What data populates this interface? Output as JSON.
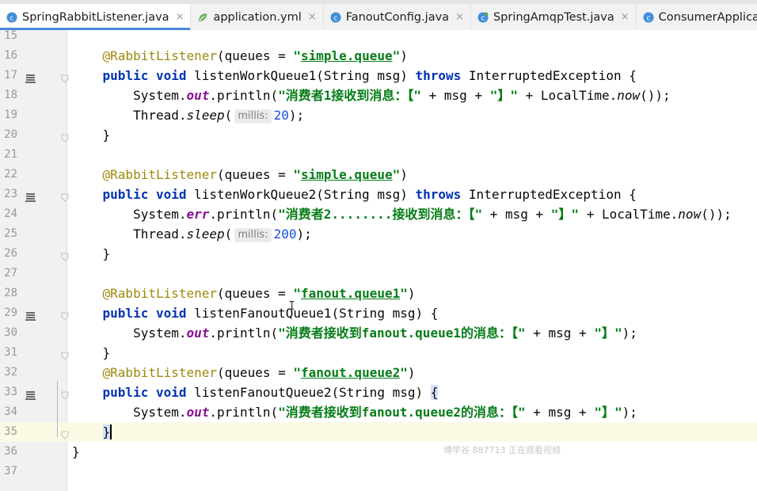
{
  "tabs": [
    {
      "label": "SpringRabbitListener.java",
      "icon": "java-class-icon",
      "active": true,
      "closable": true
    },
    {
      "label": "application.yml",
      "icon": "yml-leaf-icon",
      "active": false,
      "closable": true
    },
    {
      "label": "FanoutConfig.java",
      "icon": "java-class-icon",
      "active": false,
      "closable": true
    },
    {
      "label": "SpringAmqpTest.java",
      "icon": "java-test-class-icon",
      "active": false,
      "closable": true
    },
    {
      "label": "ConsumerApplication.java",
      "icon": "java-class-icon",
      "active": false,
      "closable": false
    }
  ],
  "close_glyph": "×",
  "code": {
    "lines": [
      {
        "n": "15",
        "tokens": []
      },
      {
        "n": "16",
        "tokens": [
          [
            "ann",
            "    @RabbitListener"
          ],
          [
            "p",
            "(queues = "
          ],
          [
            "str",
            "\""
          ],
          [
            "strlnk",
            "simple.queue"
          ],
          [
            "str",
            "\""
          ],
          [
            "p",
            ")"
          ]
        ]
      },
      {
        "n": "17",
        "run": true,
        "fold": true,
        "tokens": [
          [
            "kw",
            "    public void "
          ],
          [
            "p",
            "listenWorkQueue1(String msg) "
          ],
          [
            "kw",
            "throws "
          ],
          [
            "p",
            "InterruptedException {"
          ]
        ]
      },
      {
        "n": "18",
        "tokens": [
          [
            "p",
            "        System."
          ],
          [
            "fld",
            "out"
          ],
          [
            "p",
            ".println("
          ],
          [
            "str",
            "\"消费者1接收到消息：【\""
          ],
          [
            "p",
            " + msg + "
          ],
          [
            "str",
            "\"】\""
          ],
          [
            "p",
            " + LocalTime."
          ],
          [
            "itl",
            "now"
          ],
          [
            "p",
            "());"
          ]
        ]
      },
      {
        "n": "19",
        "tokens": [
          [
            "p",
            "        Thread."
          ],
          [
            "itl",
            "sleep"
          ],
          [
            "p",
            "("
          ],
          [
            "hint",
            "millis:"
          ],
          [
            "num",
            "20"
          ],
          [
            "p",
            ");"
          ]
        ]
      },
      {
        "n": "20",
        "fold": true,
        "tokens": [
          [
            "p",
            "    }"
          ]
        ]
      },
      {
        "n": "21",
        "tokens": []
      },
      {
        "n": "22",
        "tokens": [
          [
            "ann",
            "    @RabbitListener"
          ],
          [
            "p",
            "(queues = "
          ],
          [
            "str",
            "\""
          ],
          [
            "strlnk",
            "simple.queue"
          ],
          [
            "str",
            "\""
          ],
          [
            "p",
            ")"
          ]
        ]
      },
      {
        "n": "23",
        "run": true,
        "fold": true,
        "tokens": [
          [
            "kw",
            "    public void "
          ],
          [
            "p",
            "listenWorkQueue2(String msg) "
          ],
          [
            "kw",
            "throws "
          ],
          [
            "p",
            "InterruptedException {"
          ]
        ]
      },
      {
        "n": "24",
        "tokens": [
          [
            "p",
            "        System."
          ],
          [
            "fld",
            "err"
          ],
          [
            "p",
            ".println("
          ],
          [
            "str",
            "\"消费者2........接收到消息：【\""
          ],
          [
            "p",
            " + msg + "
          ],
          [
            "str",
            "\"】\""
          ],
          [
            "p",
            " + LocalTime."
          ],
          [
            "itl",
            "now"
          ],
          [
            "p",
            "());"
          ]
        ]
      },
      {
        "n": "25",
        "tokens": [
          [
            "p",
            "        Thread."
          ],
          [
            "itl",
            "sleep"
          ],
          [
            "p",
            "("
          ],
          [
            "hint",
            "millis:"
          ],
          [
            "num",
            "200"
          ],
          [
            "p",
            ");"
          ]
        ]
      },
      {
        "n": "26",
        "fold": true,
        "tokens": [
          [
            "p",
            "    }"
          ]
        ]
      },
      {
        "n": "27",
        "tokens": []
      },
      {
        "n": "28",
        "tokens": [
          [
            "ann",
            "    @RabbitListener"
          ],
          [
            "p",
            "(queues = "
          ],
          [
            "str",
            "\""
          ],
          [
            "strlnk",
            "fanout.queue1"
          ],
          [
            "str",
            "\""
          ],
          [
            "p",
            ")"
          ]
        ]
      },
      {
        "n": "29",
        "run": true,
        "fold": true,
        "tokens": [
          [
            "kw",
            "    public void "
          ],
          [
            "p",
            "listenFanoutQueue1(String msg) {"
          ]
        ]
      },
      {
        "n": "30",
        "tokens": [
          [
            "p",
            "        System."
          ],
          [
            "fld",
            "out"
          ],
          [
            "p",
            ".println("
          ],
          [
            "str",
            "\"消费者接收到fanout.queue1的消息：【\""
          ],
          [
            "p",
            " + msg + "
          ],
          [
            "str",
            "\"】\""
          ],
          [
            "p",
            ");"
          ]
        ]
      },
      {
        "n": "31",
        "fold": true,
        "tokens": [
          [
            "p",
            "    }"
          ]
        ]
      },
      {
        "n": "32",
        "tokens": [
          [
            "ann",
            "    @RabbitListener"
          ],
          [
            "p",
            "(queues = "
          ],
          [
            "str",
            "\""
          ],
          [
            "strlnk",
            "fanout.queue2"
          ],
          [
            "str",
            "\""
          ],
          [
            "p",
            ")"
          ]
        ]
      },
      {
        "n": "33",
        "run": true,
        "fold": true,
        "tokens": [
          [
            "kw",
            "    public void "
          ],
          [
            "p",
            "listenFanoutQueue2(String msg) "
          ],
          [
            "bm",
            "{"
          ]
        ]
      },
      {
        "n": "34",
        "tokens": [
          [
            "p",
            "        System."
          ],
          [
            "fld",
            "out"
          ],
          [
            "p",
            ".println("
          ],
          [
            "str",
            "\"消费者接收到fanout.queue2的消息：【\""
          ],
          [
            "p",
            " + msg + "
          ],
          [
            "str",
            "\"】\""
          ],
          [
            "p",
            ");"
          ]
        ]
      },
      {
        "n": "35",
        "current": true,
        "fold": true,
        "tokens": [
          [
            "p",
            "    "
          ],
          [
            "bm",
            "}"
          ],
          [
            "caret",
            ""
          ]
        ]
      },
      {
        "n": "36",
        "tokens": [
          [
            "p",
            "}"
          ]
        ]
      },
      {
        "n": "37",
        "tokens": []
      }
    ]
  },
  "watermark": "博学谷 887713 正在观看视频",
  "mouse_cursor_glyph": "I",
  "colors": {
    "active_tab_underline": "#4a89dc",
    "annotation": "#9e880d",
    "keyword": "#0033b3",
    "string": "#067d17",
    "static_field": "#871094",
    "number": "#1750eb",
    "current_line": "#fcfae4"
  }
}
